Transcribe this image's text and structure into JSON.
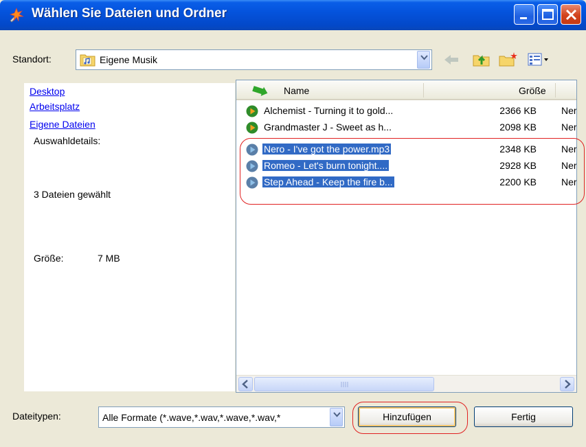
{
  "window": {
    "title": "Wählen Sie Dateien und Ordner"
  },
  "location": {
    "label": "Standort:",
    "value": "Eigene Musik"
  },
  "left_pane": {
    "links": [
      "Desktop",
      "Arbeitsplatz",
      "Eigene Dateien"
    ],
    "details_title": "Auswahldetails:",
    "selection_count": "3 Dateien gewählt",
    "size_label": "Größe:",
    "size_value": "7 MB"
  },
  "file_list": {
    "columns": {
      "name": "Name",
      "size": "Größe"
    },
    "rows": [
      {
        "name": "Alchemist - Turning it to gold...",
        "size": "2366 KB",
        "type": "Ner",
        "selected": false
      },
      {
        "name": "Grandmaster J - Sweet as h...",
        "size": "2098 KB",
        "type": "Ner",
        "selected": false
      },
      {
        "name": "Nero -  I've got the power.mp3",
        "size": "2348 KB",
        "type": "Ner",
        "selected": true
      },
      {
        "name": "Romeo -  Let's burn tonight....",
        "size": "2928 KB",
        "type": "Ner",
        "selected": true
      },
      {
        "name": "Step Ahead - Keep the fire b...",
        "size": "2200 KB",
        "type": "Ner",
        "selected": true
      }
    ]
  },
  "filetype": {
    "label": "Dateitypen:",
    "value": "Alle Formate  (*.wave,*.wav,*.wave,*.wav,*"
  },
  "buttons": {
    "add": "Hinzufügen",
    "done": "Fertig"
  },
  "colors": {
    "selection": "#316ac5",
    "highlight_ring": "#e02020"
  }
}
